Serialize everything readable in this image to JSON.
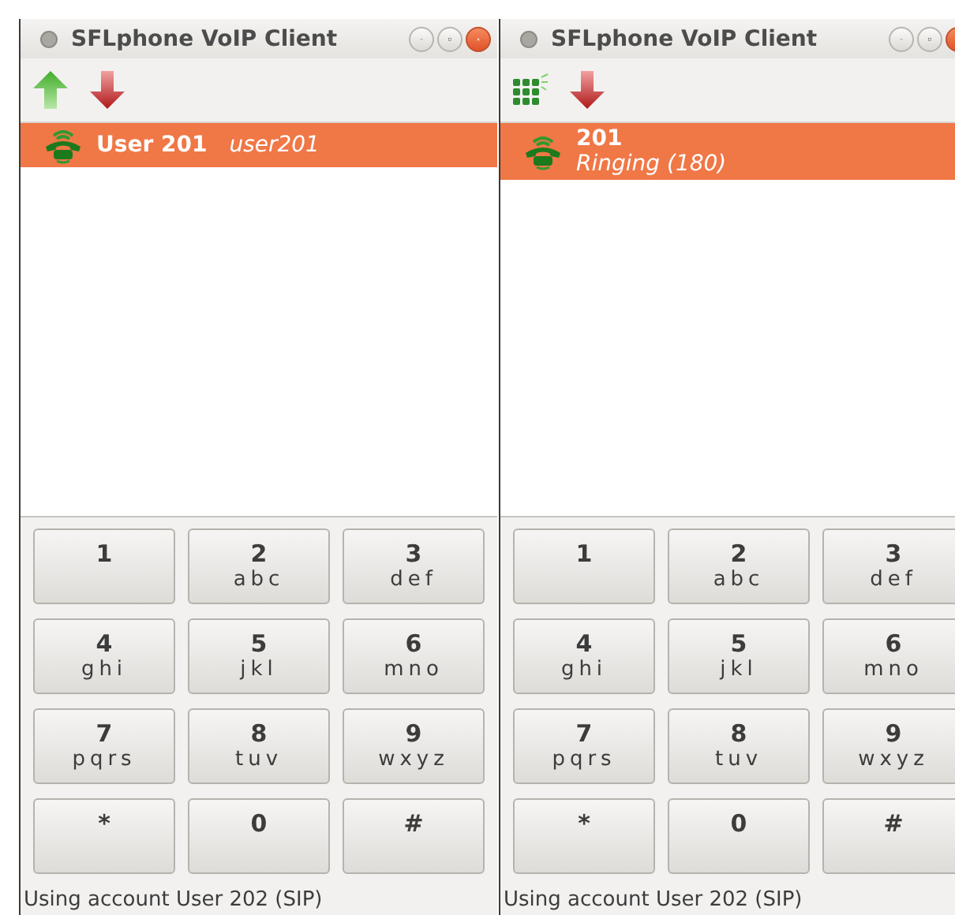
{
  "windows": [
    {
      "title": "SFLphone VoIP Client",
      "toolbar": [
        {
          "kind": "pickup"
        },
        {
          "kind": "hangup"
        }
      ],
      "calls": [
        {
          "name": "User 201",
          "detail": "user201",
          "kind": "inline",
          "selected": true
        }
      ],
      "keypad": [
        {
          "digit": "1"
        },
        {
          "digit": "2",
          "letters": "abc"
        },
        {
          "digit": "3",
          "letters": "def"
        },
        {
          "digit": "4",
          "letters": "ghi"
        },
        {
          "digit": "5",
          "letters": "jkl"
        },
        {
          "digit": "6",
          "letters": "mno"
        },
        {
          "digit": "7",
          "letters": "pqrs"
        },
        {
          "digit": "8",
          "letters": "tuv"
        },
        {
          "digit": "9",
          "letters": "wxyz"
        },
        {
          "digit": "*"
        },
        {
          "digit": "0"
        },
        {
          "digit": "#"
        }
      ],
      "status": "Using account User 202 (SIP)"
    },
    {
      "title": "SFLphone VoIP Client",
      "toolbar": [
        {
          "kind": "dialpad"
        },
        {
          "kind": "hangup"
        }
      ],
      "calls": [
        {
          "name": "201",
          "detail": "Ringing (180)",
          "kind": "stacked",
          "selected": true
        }
      ],
      "keypad": [
        {
          "digit": "1"
        },
        {
          "digit": "2",
          "letters": "abc"
        },
        {
          "digit": "3",
          "letters": "def"
        },
        {
          "digit": "4",
          "letters": "ghi"
        },
        {
          "digit": "5",
          "letters": "jkl"
        },
        {
          "digit": "6",
          "letters": "mno"
        },
        {
          "digit": "7",
          "letters": "pqrs"
        },
        {
          "digit": "8",
          "letters": "tuv"
        },
        {
          "digit": "9",
          "letters": "wxyz"
        },
        {
          "digit": "*"
        },
        {
          "digit": "0"
        },
        {
          "digit": "#"
        }
      ],
      "status": "Using account User 202 (SIP)"
    }
  ]
}
